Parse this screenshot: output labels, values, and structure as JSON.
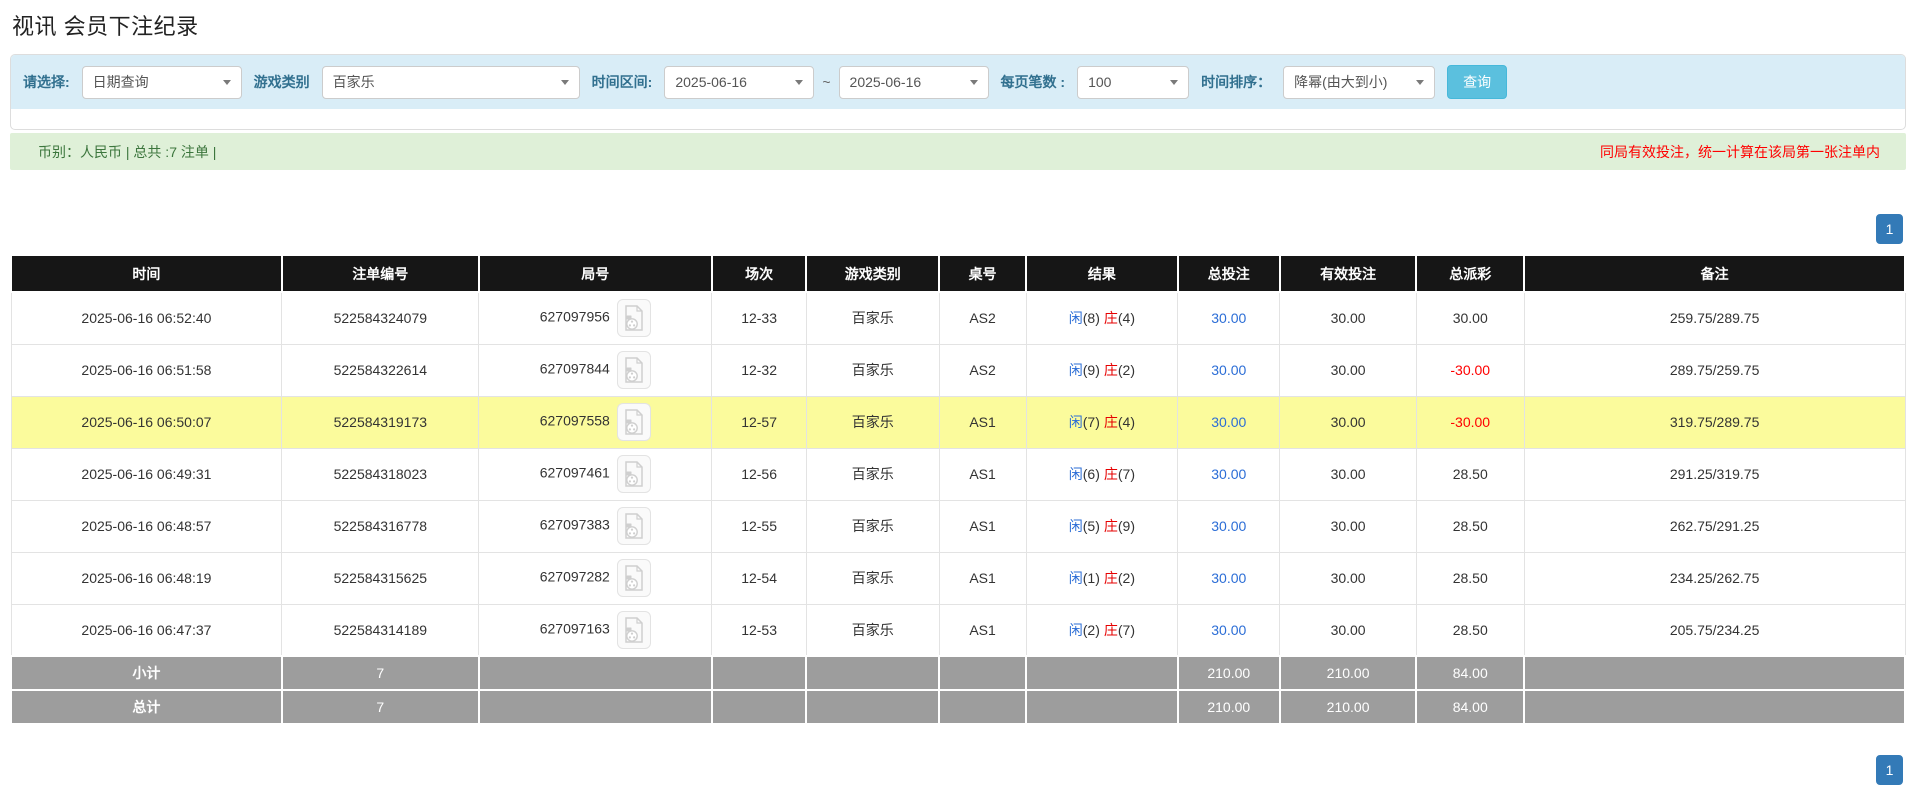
{
  "page": {
    "title": "视讯 会员下注纪录"
  },
  "colors": {
    "filter_bar_bg": "#d9edf7",
    "filter_label": "#31708f",
    "search_button_bg": "#5bc0de",
    "summary_bar_bg": "#dff0d8",
    "summary_text": "#3c763d",
    "notice_red": "#ff0000",
    "pagination_blue": "#337ab7",
    "table_header_bg": "#161616",
    "footer_row_bg": "#9d9d9d",
    "highlight_row_bg": "#fbfb9c",
    "link_blue": "#2b6dd6",
    "player_blue": "#2b6dd6",
    "banker_red": "#e60000",
    "negative_red": "#ff0000"
  },
  "filters": {
    "select_label": "请选择:",
    "select_value": "日期查询",
    "game_type_label": "游戏类别",
    "game_type_value": "百家乐",
    "date_range_label": "时间区间:",
    "date_from": "2025-06-16",
    "date_separator": "~",
    "date_to": "2025-06-16",
    "page_size_label": "每页笔数 :",
    "page_size_value": "100",
    "sort_label": "时间排序：",
    "sort_value": "降幂(由大到小)",
    "search_button": "查询"
  },
  "summary": {
    "left_text": "币别：人民币 | 总共 :7 注单 |",
    "right_notice": "同局有效投注，统一计算在该局第一张注单内"
  },
  "pagination": {
    "current_page": "1"
  },
  "table": {
    "headers": [
      "时间",
      "注单编号",
      "局号",
      "场次",
      "游戏类别",
      "桌号",
      "结果",
      "总投注",
      "有效投注",
      "总派彩",
      "备注"
    ],
    "video_icon": "film-file-icon",
    "rows": [
      {
        "time": "2025-06-16 06:52:40",
        "bet_id": "522584324079",
        "round_id": "627097956",
        "session": "12-33",
        "game": "百家乐",
        "table_no": "AS2",
        "player_label": "闲",
        "player_score": "(8)",
        "banker_label": "庄",
        "banker_score": "(4)",
        "total_bet": "30.00",
        "valid_bet": "30.00",
        "payout": "30.00",
        "remark": "259.75/289.75",
        "highlight": false
      },
      {
        "time": "2025-06-16 06:51:58",
        "bet_id": "522584322614",
        "round_id": "627097844",
        "session": "12-32",
        "game": "百家乐",
        "table_no": "AS2",
        "player_label": "闲",
        "player_score": "(9)",
        "banker_label": "庄",
        "banker_score": "(2)",
        "total_bet": "30.00",
        "valid_bet": "30.00",
        "payout": "-30.00",
        "remark": "289.75/259.75",
        "highlight": false
      },
      {
        "time": "2025-06-16 06:50:07",
        "bet_id": "522584319173",
        "round_id": "627097558",
        "session": "12-57",
        "game": "百家乐",
        "table_no": "AS1",
        "player_label": "闲",
        "player_score": "(7)",
        "banker_label": "庄",
        "banker_score": "(4)",
        "total_bet": "30.00",
        "valid_bet": "30.00",
        "payout": "-30.00",
        "remark": "319.75/289.75",
        "highlight": true
      },
      {
        "time": "2025-06-16 06:49:31",
        "bet_id": "522584318023",
        "round_id": "627097461",
        "session": "12-56",
        "game": "百家乐",
        "table_no": "AS1",
        "player_label": "闲",
        "player_score": "(6)",
        "banker_label": "庄",
        "banker_score": "(7)",
        "total_bet": "30.00",
        "valid_bet": "30.00",
        "payout": "28.50",
        "remark": "291.25/319.75",
        "highlight": false
      },
      {
        "time": "2025-06-16 06:48:57",
        "bet_id": "522584316778",
        "round_id": "627097383",
        "session": "12-55",
        "game": "百家乐",
        "table_no": "AS1",
        "player_label": "闲",
        "player_score": "(5)",
        "banker_label": "庄",
        "banker_score": "(9)",
        "total_bet": "30.00",
        "valid_bet": "30.00",
        "payout": "28.50",
        "remark": "262.75/291.25",
        "highlight": false
      },
      {
        "time": "2025-06-16 06:48:19",
        "bet_id": "522584315625",
        "round_id": "627097282",
        "session": "12-54",
        "game": "百家乐",
        "table_no": "AS1",
        "player_label": "闲",
        "player_score": "(1)",
        "banker_label": "庄",
        "banker_score": "(2)",
        "total_bet": "30.00",
        "valid_bet": "30.00",
        "payout": "28.50",
        "remark": "234.25/262.75",
        "highlight": false
      },
      {
        "time": "2025-06-16 06:47:37",
        "bet_id": "522584314189",
        "round_id": "627097163",
        "session": "12-53",
        "game": "百家乐",
        "table_no": "AS1",
        "player_label": "闲",
        "player_score": "(2)",
        "banker_label": "庄",
        "banker_score": "(7)",
        "total_bet": "30.00",
        "valid_bet": "30.00",
        "payout": "28.50",
        "remark": "205.75/234.25",
        "highlight": false
      }
    ],
    "subtotal": {
      "label": "小计",
      "count": "7",
      "total_bet": "210.00",
      "valid_bet": "210.00",
      "payout": "84.00"
    },
    "total": {
      "label": "总计",
      "count": "7",
      "total_bet": "210.00",
      "valid_bet": "210.00",
      "payout": "84.00"
    }
  }
}
